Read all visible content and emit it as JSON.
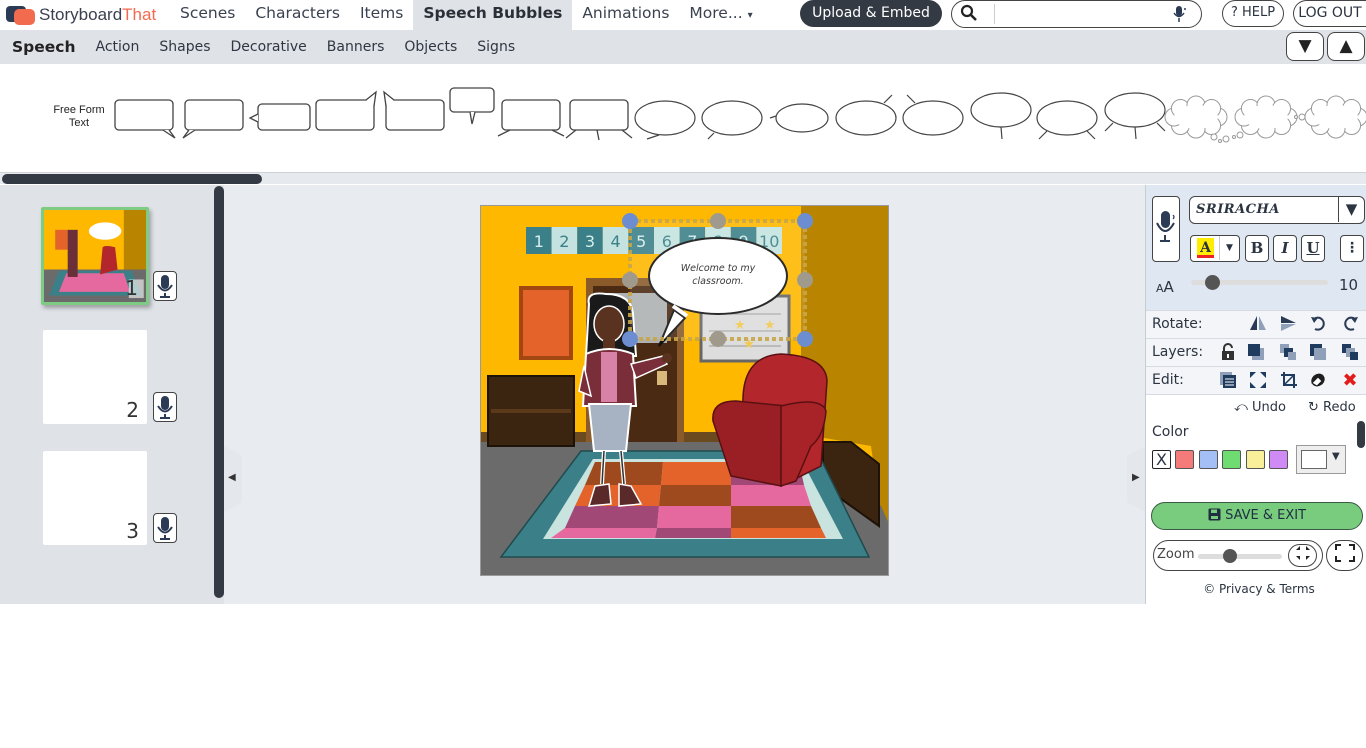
{
  "brand": {
    "name_part1": "Storyboard",
    "name_part2": "That"
  },
  "nav": {
    "items": [
      {
        "label": "Scenes",
        "active": false
      },
      {
        "label": "Characters",
        "active": false
      },
      {
        "label": "Items",
        "active": false
      },
      {
        "label": "Speech Bubbles",
        "active": true
      },
      {
        "label": "Animations",
        "active": false
      },
      {
        "label": "More...",
        "active": false
      }
    ],
    "more_caret": "▾",
    "upload_label": "Upload & Embed",
    "search": {
      "placeholder": "",
      "value": "",
      "icon": "search-icon",
      "mic_icon": "microphone-icon"
    },
    "help_label": "? HELP",
    "logout_label": "LOG OUT"
  },
  "subnav": {
    "items": [
      {
        "label": "Speech",
        "active": true
      },
      {
        "label": "Action",
        "active": false
      },
      {
        "label": "Shapes",
        "active": false
      },
      {
        "label": "Decorative",
        "active": false
      },
      {
        "label": "Banners",
        "active": false
      },
      {
        "label": "Objects",
        "active": false
      },
      {
        "label": "Signs",
        "active": false
      }
    ],
    "collapse_down": "▼",
    "collapse_up": "▲"
  },
  "palette": {
    "free_form_label": "Free Form Text",
    "bubble_types": [
      "rect-tail-br",
      "rect-tail-bl",
      "rect-tail-left",
      "rect-tail-tr",
      "rect-tail-tl",
      "rect-tail-bottom",
      "rect-tail-both",
      "rect-tail-three",
      "oval-tail-br",
      "oval-tail-bl",
      "oval-tail-left",
      "oval-tail-tr",
      "oval-tail-tl",
      "oval-tail-bottom",
      "oval-tail-both",
      "oval-tail-three",
      "thought-br",
      "thought-bl",
      "thought-left"
    ],
    "scroll_fraction": 0.19
  },
  "storyboard": {
    "cells": [
      {
        "number": "1",
        "selected": true,
        "has_content": true
      },
      {
        "number": "2",
        "selected": false,
        "has_content": false
      },
      {
        "number": "3",
        "selected": false,
        "has_content": false
      }
    ],
    "collapse_left_glyph": "◀",
    "collapse_right_glyph": "▶"
  },
  "scene": {
    "number_strip": [
      "1",
      "2",
      "3",
      "4",
      "5",
      "6",
      "7",
      "8",
      "9",
      "10"
    ],
    "speech_text": "Welcome to my classroom.",
    "colors": {
      "wall": "#ffb800",
      "wall_side": "#b98500",
      "floor": "#6b6b6b",
      "rug_border": "#3b8088",
      "chair": "#b3262b"
    }
  },
  "props": {
    "font_name": "SRIRACHA",
    "font_caret": "▼",
    "text_color_glyph": "A",
    "bold": "B",
    "italic": "I",
    "underline": "U",
    "more_glyph": "⋮",
    "size_icon": "AA",
    "font_size": "10",
    "font_size_fraction": 0.1,
    "rotate_label": "Rotate:",
    "layers_label": "Layers:",
    "edit_label": "Edit:",
    "undo_label": "Undo",
    "redo_label": "Redo",
    "color_label": "Color",
    "clear_swatch": "X",
    "swatches": [
      "#f57b7b",
      "#a3bff5",
      "#6fdc72",
      "#f9ef9a",
      "#d08af5"
    ],
    "selected_color": "#ffffff",
    "save_label": "SAVE & EXIT",
    "zoom_label": "Zoom",
    "zoom_fraction": 0.3,
    "privacy_label": "© Privacy & Terms"
  }
}
